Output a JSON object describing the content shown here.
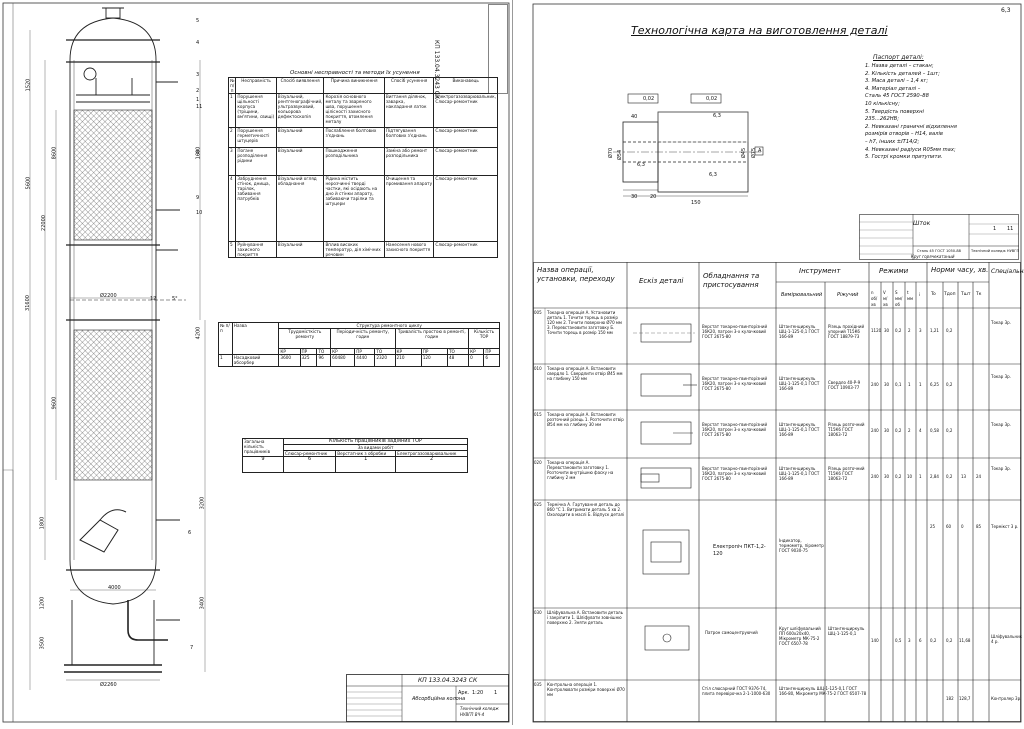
{
  "left_sheet": {
    "callouts": [
      "5",
      "4",
      "3",
      "2",
      "1",
      "11",
      "8",
      "9",
      "10",
      "6",
      "7",
      "12"
    ],
    "dims_vertical": [
      "1520",
      "5600",
      "31600",
      "22000",
      "8600",
      "9600",
      "4200",
      "1600",
      "1800",
      "1200",
      "3500",
      "3200",
      "3400"
    ],
    "dims_horizontal": [
      "Ø2200",
      "Ø2260",
      "4000",
      "5°"
    ],
    "defects_table": {
      "title": "Основні несправності та методи їх усунення",
      "headers": [
        "№ п/п",
        "Несправність",
        "Спосіб виявлення",
        "Причина виникнення",
        "Спосіб усунення",
        "Виконавець"
      ],
      "rows": [
        [
          "1",
          "Порушення щільності корпуса (тріщини, вм'ятини, свищі)",
          "Візуальний, рентгенографічний, ультразвуковий, кольорова дефектоскопія",
          "Корозія основного металу та звареного шва, порушення цілісності захисного покриття, втомлення металу",
          "Вигтання ділянок, заварка, накладання латок",
          "Електрогазозварювальник, Слюсар-ремонтник"
        ],
        [
          "2",
          "Порушення герметичності штуцерів",
          "Візуальний",
          "Послаблення болтових з'єднань",
          "Підтягування болтових з'єднань",
          "Слюсар-ремонтник"
        ],
        [
          "3",
          "Погане розподілення рідини",
          "Візуальний",
          "Пошкодження розподільника",
          "Заміна або ремонт розподільника",
          "Слюсар-ремонтник"
        ],
        [
          "4",
          "Забруднення стінок, днища, тарілок, забивання патрубків",
          "Візуальний огляд обладнання",
          "Рідина містить нерозчинні тверді частки, які осідають на дно й стінки апарату, забиваючи тарілки та штуцери",
          "Очищення та промивання апарату",
          "Слюсар-ремонтник"
        ],
        [
          "5",
          "Руйнування захисного покриття",
          "Візуальний",
          "Вплив високих температур, дія хімічних речовин",
          "Нанесення нового захисного покриття",
          "Слюсар-ремонтник"
        ]
      ]
    },
    "repair_cycle_table": {
      "title": "Структура ремонтного циклу",
      "group_headers": [
        "Трудомісткість ремонту",
        "Періодичність ремонту, годин",
        "Тривалість простою в ремонті, годин",
        "Кількість ТОР"
      ],
      "sub_headers": [
        "КР",
        "ПР",
        "ТО",
        "КР",
        "ПР",
        "ТО",
        "КР",
        "ПР",
        "ТО",
        "КР",
        "ПР"
      ],
      "row_headers": [
        "№ п/п",
        "Назва"
      ],
      "row": [
        "1",
        "Насадковий абсорбер",
        "3600",
        "325",
        "96",
        "60480",
        "4440",
        "2320",
        "210",
        "120",
        "48",
        "0",
        "6",
        "12"
      ]
    },
    "tor_table": {
      "title": "Кількість працівників задіяних TOP",
      "headers": [
        "Загальна кількість працівників",
        "Слюсар-ремонтник",
        "Верстатник з обробки",
        "Електрогазозварювальник"
      ],
      "sub_header": "За видами робіт",
      "values": [
        "9",
        "6",
        "1",
        "2"
      ]
    },
    "stamp": {
      "code": "КП 133.04.3243 СК",
      "name": "Абсорбційна колона",
      "org": "Технічний коледж НУВГП ВЧ-4",
      "sheet_label": "Арк.",
      "sheets": "1",
      "scale": "1:20",
      "rotated_code": "КП 133.04.3243 СК"
    }
  },
  "right_sheet": {
    "title": "Технологічна карта на виготовлення деталі",
    "passport": {
      "heading": "Паспорт деталі:",
      "lines": [
        "1. Назва деталі – стакан;",
        "2. Кількість деталей – 1шт;",
        "3. Маса деталі – 1,4 кг;",
        "4. Матеріал деталі –",
        "Сталь 45 ГОСТ 2590–88",
        "10 кількісну;",
        "5. Твердість поверхні",
        "235...262HB;",
        "2. Невказані граничні відхилення",
        "розмірів отворів – H14, валів",
        "– h7, інших ±IT14/2;",
        "4. Невказані радіуси R05мм max;",
        "5. Гострі кромки притупити."
      ]
    },
    "part_labels": {
      "tol1": "0,02",
      "tol2": "0,02",
      "datum": "A",
      "dims": [
        "40",
        "6,3",
        "Ø70",
        "Ø54",
        "Ø45",
        "Ø75",
        "6,3",
        "6,3",
        "30",
        "20",
        "150"
      ],
      "corner": "6,3"
    },
    "mini_stamp": {
      "name": "Шток",
      "material": "Сталь 45 ГОСТ 1050-88",
      "note": "Круг горячекатаный",
      "sheet": "1",
      "sheets": "11",
      "org": "Технічний коледж НУВГП"
    },
    "table_headers": {
      "operation": "Назва операції, установки, переходу",
      "sketch": "Ескіз деталі",
      "equipment": "Обладнання та пристосування",
      "tools": "Інструмент",
      "tools_measuring": "Вимірювальний",
      "tools_cutting": "Ріжучий",
      "modes": "Режими",
      "modes_cols": [
        "n об/хв",
        "V м/хв",
        "S мм/об",
        "t мм",
        "i"
      ],
      "norms": "Норми часу, хв.",
      "norms_cols": [
        "To",
        "Тдоп",
        "Тшт",
        "Тк"
      ],
      "specialty": "Спеціальність"
    },
    "operations": [
      {
        "no": "005",
        "text": "Токарна операція А. Установити деталь 1. Точити торець в розмір 120 мм 2. Точити поверхню Ø70 мм 3. Перевстановити заготовку Б. Точити торець в розмір 150 мм",
        "equip": "Верстат токарно-гвинторізний 16К20, патрон 3-х кулачковий ГОСТ 2675-80",
        "meas": "Штангенциркуль ШЦ-1-125-0,1 ГОСТ 166-89",
        "cut": "Різець прохідний упорний Т15К6 ГОСТ 18879-73",
        "n": "1120",
        "V": "30",
        "S": "0,2",
        "t": "2",
        "i": "3",
        "To": "1,21",
        "Tdop": "0,2",
        "Tsht": "",
        "Tk": "",
        "spec": "Токар 3р."
      },
      {
        "no": "010",
        "text": "Токарна операція А. Встановити свердло 1. Свердлити отвір Ø45 мм на глибину 150 мм",
        "equip": "Верстат токарно-гвинторізний 16К20, патрон 3-х кулачковий ГОСТ 2675-80",
        "meas": "Штангенциркуль ШЦ-1-125-0,1 ГОСТ 166-89",
        "cut": "Свердло 40-Р-9 ГОСТ 10903-77",
        "n": "240",
        "V": "30",
        "S": "0,1",
        "t": "1",
        "i": "1",
        "To": "6,25",
        "Tdop": "0,2",
        "Tsht": "",
        "Tk": "",
        "spec": "Токар 3р."
      },
      {
        "no": "015",
        "text": "Токарна операція А. Встановити розточний різець 1. Розточити отвір Ø54 мм на глибину 30 мм",
        "equip": "Верстат токарно-гвинторізний 16К20, патрон 3-х кулачковий ГОСТ 2675-80",
        "meas": "Штангенциркуль ШЦ-1-125-0,1 ГОСТ 166-89",
        "cut": "Різець розточний Т15К6 ГОСТ 18063-72",
        "n": "240",
        "V": "30",
        "S": "0,2",
        "t": "2",
        "i": "4",
        "To": "0,58",
        "Tdop": "0,2",
        "Tsht": "",
        "Tk": "",
        "spec": "Токар 3р."
      },
      {
        "no": "020",
        "text": "Токарна операція А. Перевстановити заготовку 1. Розточити внутрішню фаску на глибину 2 мм",
        "equip": "Верстат токарно-гвинторізний 16К20, патрон 3-х кулачковий ГОСТ 2675-80",
        "meas": "Штангенциркуль ШЦ-1-125-0,1 ГОСТ 166-89",
        "cut": "Різець розточний Т15К6 ГОСТ 18063-72",
        "n": "240",
        "V": "30",
        "S": "0,2",
        "t": "10",
        "i": "1",
        "To": "2,84",
        "Tdop": "0,2",
        "Tsht": "13",
        "Tk": "24",
        "spec": "Токар 3р."
      },
      {
        "no": "025",
        "text": "Термічна А. Гартування деталь до 860 °С 1. Витримати деталь 5 хв 2. Охолодити в маслі Б. Відпуск деталі",
        "equip": "Електропіч ПКТ-1,2-120",
        "meas": "Індикатор, термометр, пірометр ГОСТ 9030-75",
        "cut": "",
        "n": "",
        "V": "",
        "S": "",
        "t": "",
        "i": "",
        "To": "25",
        "Tdop": "60",
        "Tsht": "0",
        "Tk": "85",
        "spec": "Термікст 3 р."
      },
      {
        "no": "030",
        "text": "Шліфувальна А. Встановити деталь і закріпити 1. Шліфувати зовнішню поверхню 2. Зняти деталь",
        "equip": "Патрон самоцентруючий",
        "meas": "Круг шліфувальний ПП 600х20х40, Мікрометр МК-75-2 ГОСТ 6507-78",
        "cut": "Штангенциркуль ШЦ-1-125-0,1",
        "n": "140",
        "V": "",
        "S": "0,5",
        "t": "3",
        "i": "6",
        "To": "0,2",
        "Tdop": "0,2",
        "Tsht": "11,68",
        "Tk": "",
        "spec": "Шліфувальник 4 р."
      },
      {
        "no": "035",
        "text": "Контрольна операція 1. Контролювати розміри поверхні Ø70 мм",
        "equip": "Стіл слюсарний ГОСТ 9376-74, плита перевірочна 2-1-1000-630",
        "meas": "Штангенциркуль ШЦ-1-125-0,1 ГОСТ 166-80, Мікрометр МК-75-2 ГОСТ 6507-78",
        "cut": "",
        "n": "",
        "V": "",
        "S": "",
        "t": "",
        "i": "",
        "To": "",
        "Tdop": "182",
        "Tsht": "128,7",
        "Tk": "",
        "spec": "Контролер 3р."
      }
    ]
  }
}
